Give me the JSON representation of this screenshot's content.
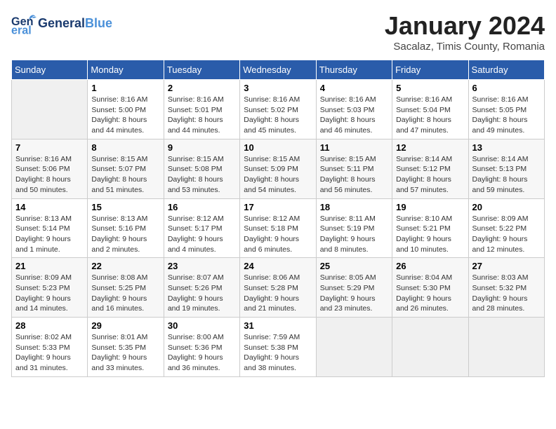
{
  "header": {
    "logo_gen": "General",
    "logo_blue": "Blue",
    "month_title": "January 2024",
    "subtitle": "Sacalaz, Timis County, Romania"
  },
  "days_of_week": [
    "Sunday",
    "Monday",
    "Tuesday",
    "Wednesday",
    "Thursday",
    "Friday",
    "Saturday"
  ],
  "weeks": [
    [
      {
        "day": "",
        "sunrise": "",
        "sunset": "",
        "daylight": ""
      },
      {
        "day": "1",
        "sunrise": "Sunrise: 8:16 AM",
        "sunset": "Sunset: 5:00 PM",
        "daylight": "Daylight: 8 hours and 44 minutes."
      },
      {
        "day": "2",
        "sunrise": "Sunrise: 8:16 AM",
        "sunset": "Sunset: 5:01 PM",
        "daylight": "Daylight: 8 hours and 44 minutes."
      },
      {
        "day": "3",
        "sunrise": "Sunrise: 8:16 AM",
        "sunset": "Sunset: 5:02 PM",
        "daylight": "Daylight: 8 hours and 45 minutes."
      },
      {
        "day": "4",
        "sunrise": "Sunrise: 8:16 AM",
        "sunset": "Sunset: 5:03 PM",
        "daylight": "Daylight: 8 hours and 46 minutes."
      },
      {
        "day": "5",
        "sunrise": "Sunrise: 8:16 AM",
        "sunset": "Sunset: 5:04 PM",
        "daylight": "Daylight: 8 hours and 47 minutes."
      },
      {
        "day": "6",
        "sunrise": "Sunrise: 8:16 AM",
        "sunset": "Sunset: 5:05 PM",
        "daylight": "Daylight: 8 hours and 49 minutes."
      }
    ],
    [
      {
        "day": "7",
        "sunrise": "Sunrise: 8:16 AM",
        "sunset": "Sunset: 5:06 PM",
        "daylight": "Daylight: 8 hours and 50 minutes."
      },
      {
        "day": "8",
        "sunrise": "Sunrise: 8:15 AM",
        "sunset": "Sunset: 5:07 PM",
        "daylight": "Daylight: 8 hours and 51 minutes."
      },
      {
        "day": "9",
        "sunrise": "Sunrise: 8:15 AM",
        "sunset": "Sunset: 5:08 PM",
        "daylight": "Daylight: 8 hours and 53 minutes."
      },
      {
        "day": "10",
        "sunrise": "Sunrise: 8:15 AM",
        "sunset": "Sunset: 5:09 PM",
        "daylight": "Daylight: 8 hours and 54 minutes."
      },
      {
        "day": "11",
        "sunrise": "Sunrise: 8:15 AM",
        "sunset": "Sunset: 5:11 PM",
        "daylight": "Daylight: 8 hours and 56 minutes."
      },
      {
        "day": "12",
        "sunrise": "Sunrise: 8:14 AM",
        "sunset": "Sunset: 5:12 PM",
        "daylight": "Daylight: 8 hours and 57 minutes."
      },
      {
        "day": "13",
        "sunrise": "Sunrise: 8:14 AM",
        "sunset": "Sunset: 5:13 PM",
        "daylight": "Daylight: 8 hours and 59 minutes."
      }
    ],
    [
      {
        "day": "14",
        "sunrise": "Sunrise: 8:13 AM",
        "sunset": "Sunset: 5:14 PM",
        "daylight": "Daylight: 9 hours and 1 minute."
      },
      {
        "day": "15",
        "sunrise": "Sunrise: 8:13 AM",
        "sunset": "Sunset: 5:16 PM",
        "daylight": "Daylight: 9 hours and 2 minutes."
      },
      {
        "day": "16",
        "sunrise": "Sunrise: 8:12 AM",
        "sunset": "Sunset: 5:17 PM",
        "daylight": "Daylight: 9 hours and 4 minutes."
      },
      {
        "day": "17",
        "sunrise": "Sunrise: 8:12 AM",
        "sunset": "Sunset: 5:18 PM",
        "daylight": "Daylight: 9 hours and 6 minutes."
      },
      {
        "day": "18",
        "sunrise": "Sunrise: 8:11 AM",
        "sunset": "Sunset: 5:19 PM",
        "daylight": "Daylight: 9 hours and 8 minutes."
      },
      {
        "day": "19",
        "sunrise": "Sunrise: 8:10 AM",
        "sunset": "Sunset: 5:21 PM",
        "daylight": "Daylight: 9 hours and 10 minutes."
      },
      {
        "day": "20",
        "sunrise": "Sunrise: 8:09 AM",
        "sunset": "Sunset: 5:22 PM",
        "daylight": "Daylight: 9 hours and 12 minutes."
      }
    ],
    [
      {
        "day": "21",
        "sunrise": "Sunrise: 8:09 AM",
        "sunset": "Sunset: 5:23 PM",
        "daylight": "Daylight: 9 hours and 14 minutes."
      },
      {
        "day": "22",
        "sunrise": "Sunrise: 8:08 AM",
        "sunset": "Sunset: 5:25 PM",
        "daylight": "Daylight: 9 hours and 16 minutes."
      },
      {
        "day": "23",
        "sunrise": "Sunrise: 8:07 AM",
        "sunset": "Sunset: 5:26 PM",
        "daylight": "Daylight: 9 hours and 19 minutes."
      },
      {
        "day": "24",
        "sunrise": "Sunrise: 8:06 AM",
        "sunset": "Sunset: 5:28 PM",
        "daylight": "Daylight: 9 hours and 21 minutes."
      },
      {
        "day": "25",
        "sunrise": "Sunrise: 8:05 AM",
        "sunset": "Sunset: 5:29 PM",
        "daylight": "Daylight: 9 hours and 23 minutes."
      },
      {
        "day": "26",
        "sunrise": "Sunrise: 8:04 AM",
        "sunset": "Sunset: 5:30 PM",
        "daylight": "Daylight: 9 hours and 26 minutes."
      },
      {
        "day": "27",
        "sunrise": "Sunrise: 8:03 AM",
        "sunset": "Sunset: 5:32 PM",
        "daylight": "Daylight: 9 hours and 28 minutes."
      }
    ],
    [
      {
        "day": "28",
        "sunrise": "Sunrise: 8:02 AM",
        "sunset": "Sunset: 5:33 PM",
        "daylight": "Daylight: 9 hours and 31 minutes."
      },
      {
        "day": "29",
        "sunrise": "Sunrise: 8:01 AM",
        "sunset": "Sunset: 5:35 PM",
        "daylight": "Daylight: 9 hours and 33 minutes."
      },
      {
        "day": "30",
        "sunrise": "Sunrise: 8:00 AM",
        "sunset": "Sunset: 5:36 PM",
        "daylight": "Daylight: 9 hours and 36 minutes."
      },
      {
        "day": "31",
        "sunrise": "Sunrise: 7:59 AM",
        "sunset": "Sunset: 5:38 PM",
        "daylight": "Daylight: 9 hours and 38 minutes."
      },
      {
        "day": "",
        "sunrise": "",
        "sunset": "",
        "daylight": ""
      },
      {
        "day": "",
        "sunrise": "",
        "sunset": "",
        "daylight": ""
      },
      {
        "day": "",
        "sunrise": "",
        "sunset": "",
        "daylight": ""
      }
    ]
  ]
}
